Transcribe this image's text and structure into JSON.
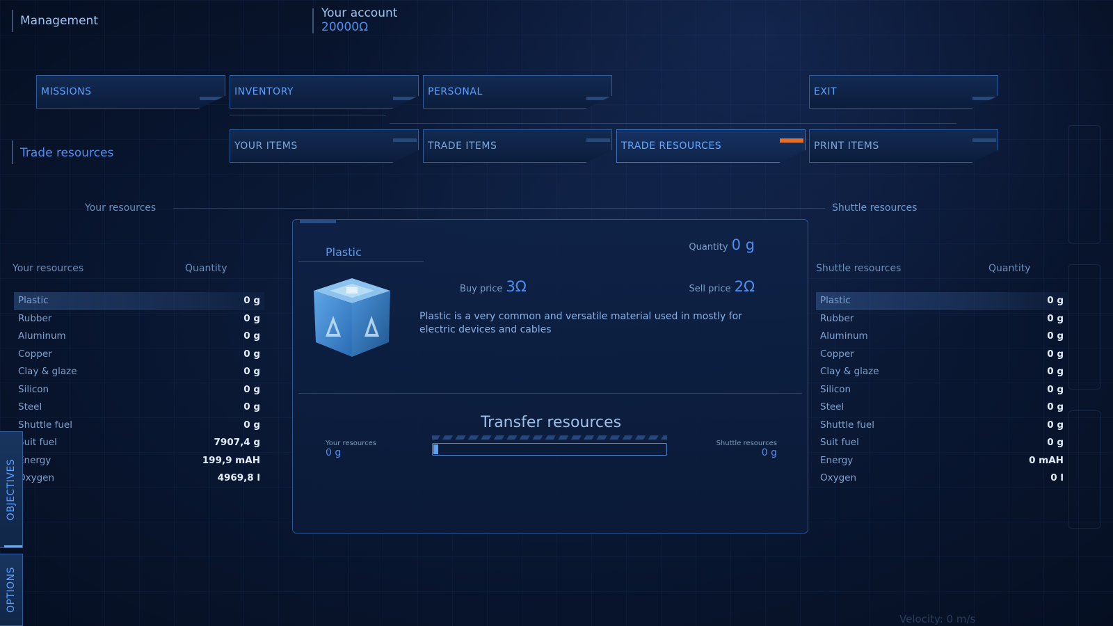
{
  "header": {
    "title": "Management",
    "account_label": "Your account",
    "account_value": "20000Ω"
  },
  "main_tabs": [
    {
      "label": "MISSIONS"
    },
    {
      "label": "INVENTORY"
    },
    {
      "label": "PERSONAL"
    },
    {
      "label": "EXIT"
    }
  ],
  "sub_tabs": [
    {
      "label": "YOUR ITEMS"
    },
    {
      "label": "TRADE ITEMS"
    },
    {
      "label": "TRADE RESOURCES"
    },
    {
      "label": "PRINT ITEMS"
    }
  ],
  "section_title": "Trade resources",
  "your_resources_heading": "Your resources",
  "shuttle_resources_heading": "Shuttle resources",
  "left_table": {
    "col_name": "Your resources",
    "col_qty": "Quantity",
    "rows": [
      {
        "name": "Plastic",
        "qty": "0 g"
      },
      {
        "name": "Rubber",
        "qty": "0 g"
      },
      {
        "name": "Aluminum",
        "qty": "0 g"
      },
      {
        "name": "Copper",
        "qty": "0 g"
      },
      {
        "name": "Clay & glaze",
        "qty": "0 g"
      },
      {
        "name": "Silicon",
        "qty": "0 g"
      },
      {
        "name": "Steel",
        "qty": "0 g"
      },
      {
        "name": "Shuttle fuel",
        "qty": "0 g"
      },
      {
        "name": "Suit fuel",
        "qty": "7907,4 g"
      },
      {
        "name": "Energy",
        "qty": "199,9 mAH"
      },
      {
        "name": "Oxygen",
        "qty": "4969,8 l"
      }
    ]
  },
  "right_table": {
    "col_name": "Shuttle resources",
    "col_qty": "Quantity",
    "rows": [
      {
        "name": "Plastic",
        "qty": "0 g"
      },
      {
        "name": "Rubber",
        "qty": "0 g"
      },
      {
        "name": "Aluminum",
        "qty": "0 g"
      },
      {
        "name": "Copper",
        "qty": "0 g"
      },
      {
        "name": "Clay & glaze",
        "qty": "0 g"
      },
      {
        "name": "Silicon",
        "qty": "0 g"
      },
      {
        "name": "Steel",
        "qty": "0 g"
      },
      {
        "name": "Shuttle fuel",
        "qty": "0 g"
      },
      {
        "name": "Suit fuel",
        "qty": "0 g"
      },
      {
        "name": "Energy",
        "qty": "0 mAH"
      },
      {
        "name": "Oxygen",
        "qty": "0 l"
      }
    ]
  },
  "detail": {
    "item_name": "Plastic",
    "quantity_label": "Quantity",
    "quantity_value": "0 g",
    "buy_label": "Buy price",
    "buy_value": "3Ω",
    "sell_label": "Sell price",
    "sell_value": "2Ω",
    "description": "Plastic is a very common and versatile material used in mostly for electric devices and cables",
    "icon": "recycle-cube-icon"
  },
  "transfer": {
    "title": "Transfer resources",
    "left_label": "Your resources",
    "left_value": "0 g",
    "right_label": "Shuttle resources",
    "right_value": "0 g",
    "slider_fraction": 0.02
  },
  "side_tabs": {
    "objectives": "OBJECTIVES",
    "options": "OPTIONS"
  },
  "footer": {
    "velocity": "Velocity: 0 m/s"
  },
  "colors": {
    "accent": "#4f8ef0",
    "active_marker": "#e2702a",
    "background": "#091630"
  }
}
